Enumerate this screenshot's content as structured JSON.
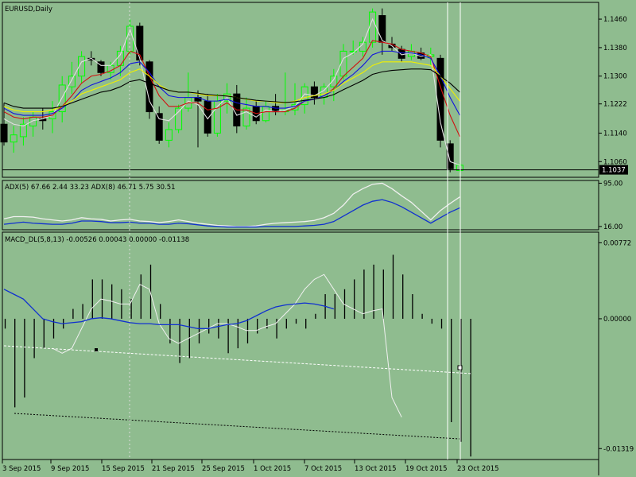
{
  "chart_data": [
    {
      "type": "candlestick",
      "title": "EURUSD,Daily",
      "current_price_label": "1.1037",
      "yticks": [
        "1.1460",
        "1.1380",
        "1.1300",
        "1.1222",
        "1.1140",
        "1.1060"
      ],
      "ytick_values": [
        1.146,
        1.138,
        1.13,
        1.1222,
        1.114,
        1.106
      ],
      "ylim": [
        1.1016,
        1.1507
      ],
      "candles": [
        {
          "o": 1.1165,
          "h": 1.1225,
          "l": 1.1105,
          "c": 1.1115
        },
        {
          "o": 1.1115,
          "h": 1.116,
          "l": 1.1085,
          "c": 1.1135
        },
        {
          "o": 1.113,
          "h": 1.1185,
          "l": 1.1105,
          "c": 1.1165
        },
        {
          "o": 1.116,
          "h": 1.12,
          "l": 1.113,
          "c": 1.1185
        },
        {
          "o": 1.118,
          "h": 1.121,
          "l": 1.115,
          "c": 1.1175
        },
        {
          "o": 1.118,
          "h": 1.123,
          "l": 1.114,
          "c": 1.12
        },
        {
          "o": 1.12,
          "h": 1.13,
          "l": 1.117,
          "c": 1.1275
        },
        {
          "o": 1.127,
          "h": 1.134,
          "l": 1.125,
          "c": 1.13
        },
        {
          "o": 1.13,
          "h": 1.137,
          "l": 1.128,
          "c": 1.1355
        },
        {
          "o": 1.135,
          "h": 1.137,
          "l": 1.133,
          "c": 1.1345
        },
        {
          "o": 1.134,
          "h": 1.1345,
          "l": 1.13,
          "c": 1.131
        },
        {
          "o": 1.131,
          "h": 1.134,
          "l": 1.129,
          "c": 1.133
        },
        {
          "o": 1.133,
          "h": 1.1385,
          "l": 1.13,
          "c": 1.137
        },
        {
          "o": 1.137,
          "h": 1.146,
          "l": 1.136,
          "c": 1.144
        },
        {
          "o": 1.144,
          "h": 1.145,
          "l": 1.133,
          "c": 1.1345
        },
        {
          "o": 1.134,
          "h": 1.1345,
          "l": 1.118,
          "c": 1.12
        },
        {
          "o": 1.1195,
          "h": 1.1215,
          "l": 1.111,
          "c": 1.112
        },
        {
          "o": 1.112,
          "h": 1.117,
          "l": 1.11,
          "c": 1.115
        },
        {
          "o": 1.115,
          "h": 1.122,
          "l": 1.114,
          "c": 1.121
        },
        {
          "o": 1.121,
          "h": 1.131,
          "l": 1.12,
          "c": 1.124
        },
        {
          "o": 1.124,
          "h": 1.126,
          "l": 1.11,
          "c": 1.123
        },
        {
          "o": 1.123,
          "h": 1.125,
          "l": 1.113,
          "c": 1.114
        },
        {
          "o": 1.114,
          "h": 1.125,
          "l": 1.113,
          "c": 1.123
        },
        {
          "o": 1.123,
          "h": 1.128,
          "l": 1.1195,
          "c": 1.125
        },
        {
          "o": 1.125,
          "h": 1.1275,
          "l": 1.114,
          "c": 1.116
        },
        {
          "o": 1.116,
          "h": 1.124,
          "l": 1.115,
          "c": 1.121
        },
        {
          "o": 1.1215,
          "h": 1.123,
          "l": 1.1165,
          "c": 1.1175
        },
        {
          "o": 1.1175,
          "h": 1.123,
          "l": 1.117,
          "c": 1.1215
        },
        {
          "o": 1.1215,
          "h": 1.125,
          "l": 1.119,
          "c": 1.12
        },
        {
          "o": 1.12,
          "h": 1.131,
          "l": 1.119,
          "c": 1.1205
        },
        {
          "o": 1.1205,
          "h": 1.128,
          "l": 1.119,
          "c": 1.122
        },
        {
          "o": 1.122,
          "h": 1.128,
          "l": 1.1195,
          "c": 1.127
        },
        {
          "o": 1.127,
          "h": 1.1285,
          "l": 1.122,
          "c": 1.124
        },
        {
          "o": 1.124,
          "h": 1.128,
          "l": 1.122,
          "c": 1.127
        },
        {
          "o": 1.127,
          "h": 1.132,
          "l": 1.123,
          "c": 1.13
        },
        {
          "o": 1.13,
          "h": 1.139,
          "l": 1.129,
          "c": 1.137
        },
        {
          "o": 1.137,
          "h": 1.14,
          "l": 1.136,
          "c": 1.137
        },
        {
          "o": 1.137,
          "h": 1.141,
          "l": 1.1355,
          "c": 1.1395
        },
        {
          "o": 1.1395,
          "h": 1.149,
          "l": 1.138,
          "c": 1.148
        },
        {
          "o": 1.147,
          "h": 1.149,
          "l": 1.136,
          "c": 1.1395
        },
        {
          "o": 1.139,
          "h": 1.141,
          "l": 1.137,
          "c": 1.138
        },
        {
          "o": 1.1375,
          "h": 1.1385,
          "l": 1.134,
          "c": 1.135
        },
        {
          "o": 1.1355,
          "h": 1.139,
          "l": 1.1345,
          "c": 1.137
        },
        {
          "o": 1.1365,
          "h": 1.138,
          "l": 1.1345,
          "c": 1.135
        },
        {
          "o": 1.1355,
          "h": 1.138,
          "l": 1.133,
          "c": 1.136
        },
        {
          "o": 1.135,
          "h": 1.136,
          "l": 1.11,
          "c": 1.112
        },
        {
          "o": 1.111,
          "h": 1.112,
          "l": 1.103,
          "c": 1.104
        },
        {
          "o": 1.1035,
          "h": 1.1055,
          "l": 1.103,
          "c": 1.105
        }
      ],
      "moving_averages": [
        {
          "color": "#e0e0e0",
          "values": [
            1.118,
            1.1165,
            1.116,
            1.1175,
            1.118,
            1.119,
            1.124,
            1.129,
            1.134,
            1.135,
            1.133,
            1.133,
            1.136,
            1.143,
            1.135,
            1.123,
            1.118,
            1.1175,
            1.12,
            1.123,
            1.122,
            1.118,
            1.1215,
            1.124,
            1.119,
            1.12,
            1.1185,
            1.1205,
            1.12,
            1.1205,
            1.1215,
            1.125,
            1.1245,
            1.126,
            1.129,
            1.135,
            1.1365,
            1.139,
            1.146,
            1.14,
            1.1385,
            1.136,
            1.1365,
            1.1355,
            1.136,
            1.117,
            1.106,
            1.105
          ]
        },
        {
          "color": "#d01010",
          "values": [
            1.12,
            1.1185,
            1.118,
            1.1185,
            1.1185,
            1.119,
            1.1215,
            1.1245,
            1.128,
            1.13,
            1.1305,
            1.1315,
            1.133,
            1.137,
            1.136,
            1.13,
            1.1245,
            1.1215,
            1.1215,
            1.1225,
            1.1225,
            1.1205,
            1.121,
            1.1225,
            1.1205,
            1.1205,
            1.1195,
            1.12,
            1.12,
            1.12,
            1.121,
            1.123,
            1.1235,
            1.1245,
            1.1265,
            1.13,
            1.1325,
            1.135,
            1.14,
            1.1395,
            1.139,
            1.1375,
            1.137,
            1.1365,
            1.1355,
            1.127,
            1.119,
            1.113
          ]
        },
        {
          "color": "#1010e0",
          "values": [
            1.121,
            1.1195,
            1.119,
            1.119,
            1.119,
            1.1195,
            1.121,
            1.123,
            1.126,
            1.1275,
            1.1285,
            1.1295,
            1.131,
            1.1335,
            1.134,
            1.131,
            1.127,
            1.1245,
            1.124,
            1.124,
            1.124,
            1.123,
            1.123,
            1.1235,
            1.1225,
            1.122,
            1.1215,
            1.1215,
            1.121,
            1.121,
            1.1215,
            1.123,
            1.1235,
            1.1245,
            1.126,
            1.1285,
            1.1305,
            1.133,
            1.136,
            1.137,
            1.137,
            1.1365,
            1.1365,
            1.136,
            1.135,
            1.13,
            1.124,
            1.119
          ]
        },
        {
          "color": "#f0f000",
          "values": [
            1.1215,
            1.1205,
            1.12,
            1.12,
            1.12,
            1.1205,
            1.1215,
            1.123,
            1.125,
            1.126,
            1.127,
            1.128,
            1.129,
            1.131,
            1.132,
            1.13,
            1.1275,
            1.126,
            1.1255,
            1.1255,
            1.125,
            1.1245,
            1.1245,
            1.1245,
            1.124,
            1.1235,
            1.123,
            1.123,
            1.1225,
            1.1225,
            1.123,
            1.124,
            1.1245,
            1.125,
            1.126,
            1.128,
            1.1295,
            1.131,
            1.133,
            1.134,
            1.134,
            1.134,
            1.134,
            1.1335,
            1.133,
            1.13,
            1.1265,
            1.123
          ]
        },
        {
          "color": "#000000",
          "values": [
            1.1225,
            1.1215,
            1.121,
            1.121,
            1.121,
            1.121,
            1.1215,
            1.1225,
            1.1235,
            1.1245,
            1.1255,
            1.126,
            1.127,
            1.1285,
            1.129,
            1.128,
            1.127,
            1.126,
            1.1255,
            1.1255,
            1.1252,
            1.1248,
            1.1246,
            1.1244,
            1.124,
            1.1236,
            1.1232,
            1.123,
            1.1228,
            1.1226,
            1.1228,
            1.1232,
            1.1236,
            1.124,
            1.1248,
            1.1262,
            1.1275,
            1.1288,
            1.1305,
            1.1312,
            1.1316,
            1.1318,
            1.132,
            1.132,
            1.1318,
            1.13,
            1.128,
            1.1255
          ]
        }
      ]
    },
    {
      "type": "line",
      "title": "ADX(5) 67.66 2.44 33.23 ADX(8) 46.71 5.75 30.51",
      "yticks": [
        "95.00",
        "16.00"
      ],
      "ytick_values": [
        95,
        16
      ],
      "ylim": [
        10,
        100
      ],
      "series": [
        {
          "color": "#f0f0f0",
          "values": [
            30,
            34,
            34,
            33,
            30,
            28,
            26,
            28,
            32,
            30,
            29,
            26,
            28,
            29,
            26,
            25,
            23,
            25,
            28,
            25,
            22,
            20,
            18,
            17,
            16,
            16,
            17,
            20,
            22,
            23,
            24,
            25,
            27,
            32,
            40,
            55,
            75,
            85,
            93,
            95,
            85,
            72,
            60,
            44,
            28,
            45,
            58,
            70
          ]
        },
        {
          "color": "#1030d0",
          "values": [
            20,
            22,
            24,
            22,
            21,
            20,
            20,
            22,
            26,
            26,
            25,
            23,
            23,
            24,
            22,
            22,
            20,
            20,
            22,
            21,
            19,
            17,
            16,
            15,
            15,
            15,
            15,
            16,
            16,
            16,
            16,
            17,
            18,
            20,
            25,
            35,
            45,
            55,
            62,
            65,
            60,
            52,
            42,
            32,
            22,
            32,
            42,
            50
          ]
        }
      ]
    },
    {
      "type": "bar",
      "title": "MACD_DL(5,8,13) -0.00526 0.00043 0.00000 -0.01138",
      "yticks": [
        "0.00772",
        "0.00000",
        "-0.01319"
      ],
      "ytick_values": [
        0.00772,
        0,
        -0.01319
      ],
      "ylim": [
        -0.0143,
        0.0088
      ],
      "histogram": [
        -0.001,
        -0.009,
        -0.008,
        -0.004,
        -0.003,
        -0.002,
        -0.001,
        0.001,
        0.0015,
        0.004,
        0.004,
        0.0035,
        0.003,
        0.002,
        0.0045,
        0.0055,
        0.0015,
        -0.0025,
        -0.0045,
        -0.004,
        -0.0025,
        -0.0015,
        -0.002,
        -0.0035,
        -0.003,
        -0.0025,
        -0.0015,
        -0.001,
        -0.002,
        -0.001,
        -0.0005,
        -0.001,
        0.0005,
        0.0025,
        0.0025,
        0.003,
        0.004,
        0.005,
        0.0055,
        0.005,
        0.0065,
        0.0045,
        0.0025,
        0.0005,
        -0.0005,
        -0.001,
        -0.0105,
        -0.0125,
        -0.014
      ],
      "signal_line": {
        "color": "#f0f0f0",
        "values": [
          -0.003,
          -0.0035,
          -0.003,
          -0.001,
          0.001,
          0.002,
          0.0018,
          0.0015,
          0.0015,
          0.0035,
          0.003,
          -0.0005,
          -0.002,
          -0.0025,
          -0.002,
          -0.0015,
          -0.001,
          -0.0005,
          -0.0005,
          -0.0008,
          -0.0012,
          -0.0012,
          -0.0008,
          -0.0005,
          0.0005,
          0.0015,
          0.003,
          0.004,
          0.0045,
          0.003,
          0.0015,
          0.001,
          0.0005,
          0.0008,
          0.001,
          -0.008,
          -0.01
        ]
      },
      "main_line": {
        "color": "#1030d0",
        "values": [
          0.003,
          0.0025,
          0.002,
          0.001,
          0.0,
          -0.0003,
          -0.0005,
          -0.0004,
          -0.0003,
          0.0,
          0.0001,
          0.0,
          -0.0002,
          -0.0004,
          -0.0005,
          -0.0005,
          -0.0006,
          -0.0006,
          -0.0006,
          -0.0008,
          -0.001,
          -0.001,
          -0.0008,
          -0.0006,
          -0.0005,
          -0.0002,
          0.0003,
          0.0008,
          0.0012,
          0.0014,
          0.0015,
          0.0016,
          0.0015,
          0.0013,
          0.001
        ]
      }
    }
  ],
  "xticks": [
    "3 Sep 2015",
    "9 Sep 2015",
    "15 Sep 2015",
    "21 Sep 2015",
    "25 Sep 2015",
    "1 Oct 2015",
    "7 Oct 2015",
    "13 Oct 2015",
    "19 Oct 2015",
    "23 Oct 2015"
  ]
}
